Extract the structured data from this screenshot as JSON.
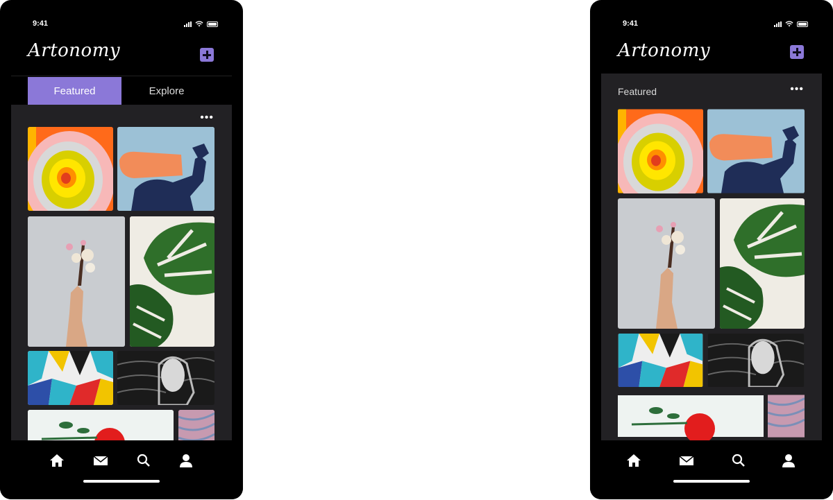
{
  "status": {
    "time": "9:41"
  },
  "app": {
    "logo": "Artonomy"
  },
  "tabs": {
    "featured": "Featured",
    "explore": "Explore"
  },
  "section": {
    "title": "Featured",
    "more": "•••"
  },
  "artworks": [
    {
      "name": "concentric-circles",
      "colors": [
        "#ff6a1a",
        "#f7b8b8",
        "#ffd900"
      ]
    },
    {
      "name": "orange-cone-figure",
      "colors": [
        "#9cc1d6",
        "#f28c59",
        "#1f2d57"
      ]
    },
    {
      "name": "hand-with-flower",
      "colors": [
        "#c9ccd0",
        "#d9a785"
      ]
    },
    {
      "name": "monstera-leaves",
      "colors": [
        "#efece4",
        "#2f6f2a"
      ]
    },
    {
      "name": "geometric-abstract",
      "colors": [
        "#2fb4c9",
        "#f2c400",
        "#e02a2a"
      ]
    },
    {
      "name": "woman-sketch",
      "colors": [
        "#1a1a1a",
        "#d8d8d8"
      ]
    },
    {
      "name": "flower-red-bowl",
      "colors": [
        "#eef3f1",
        "#e21d1d",
        "#2d6e3b"
      ]
    },
    {
      "name": "pink-marble",
      "colors": [
        "#c79ab0",
        "#7b8fb7"
      ]
    }
  ],
  "nav": {
    "items": [
      "home-icon",
      "mail-icon",
      "search-icon",
      "profile-icon"
    ]
  }
}
